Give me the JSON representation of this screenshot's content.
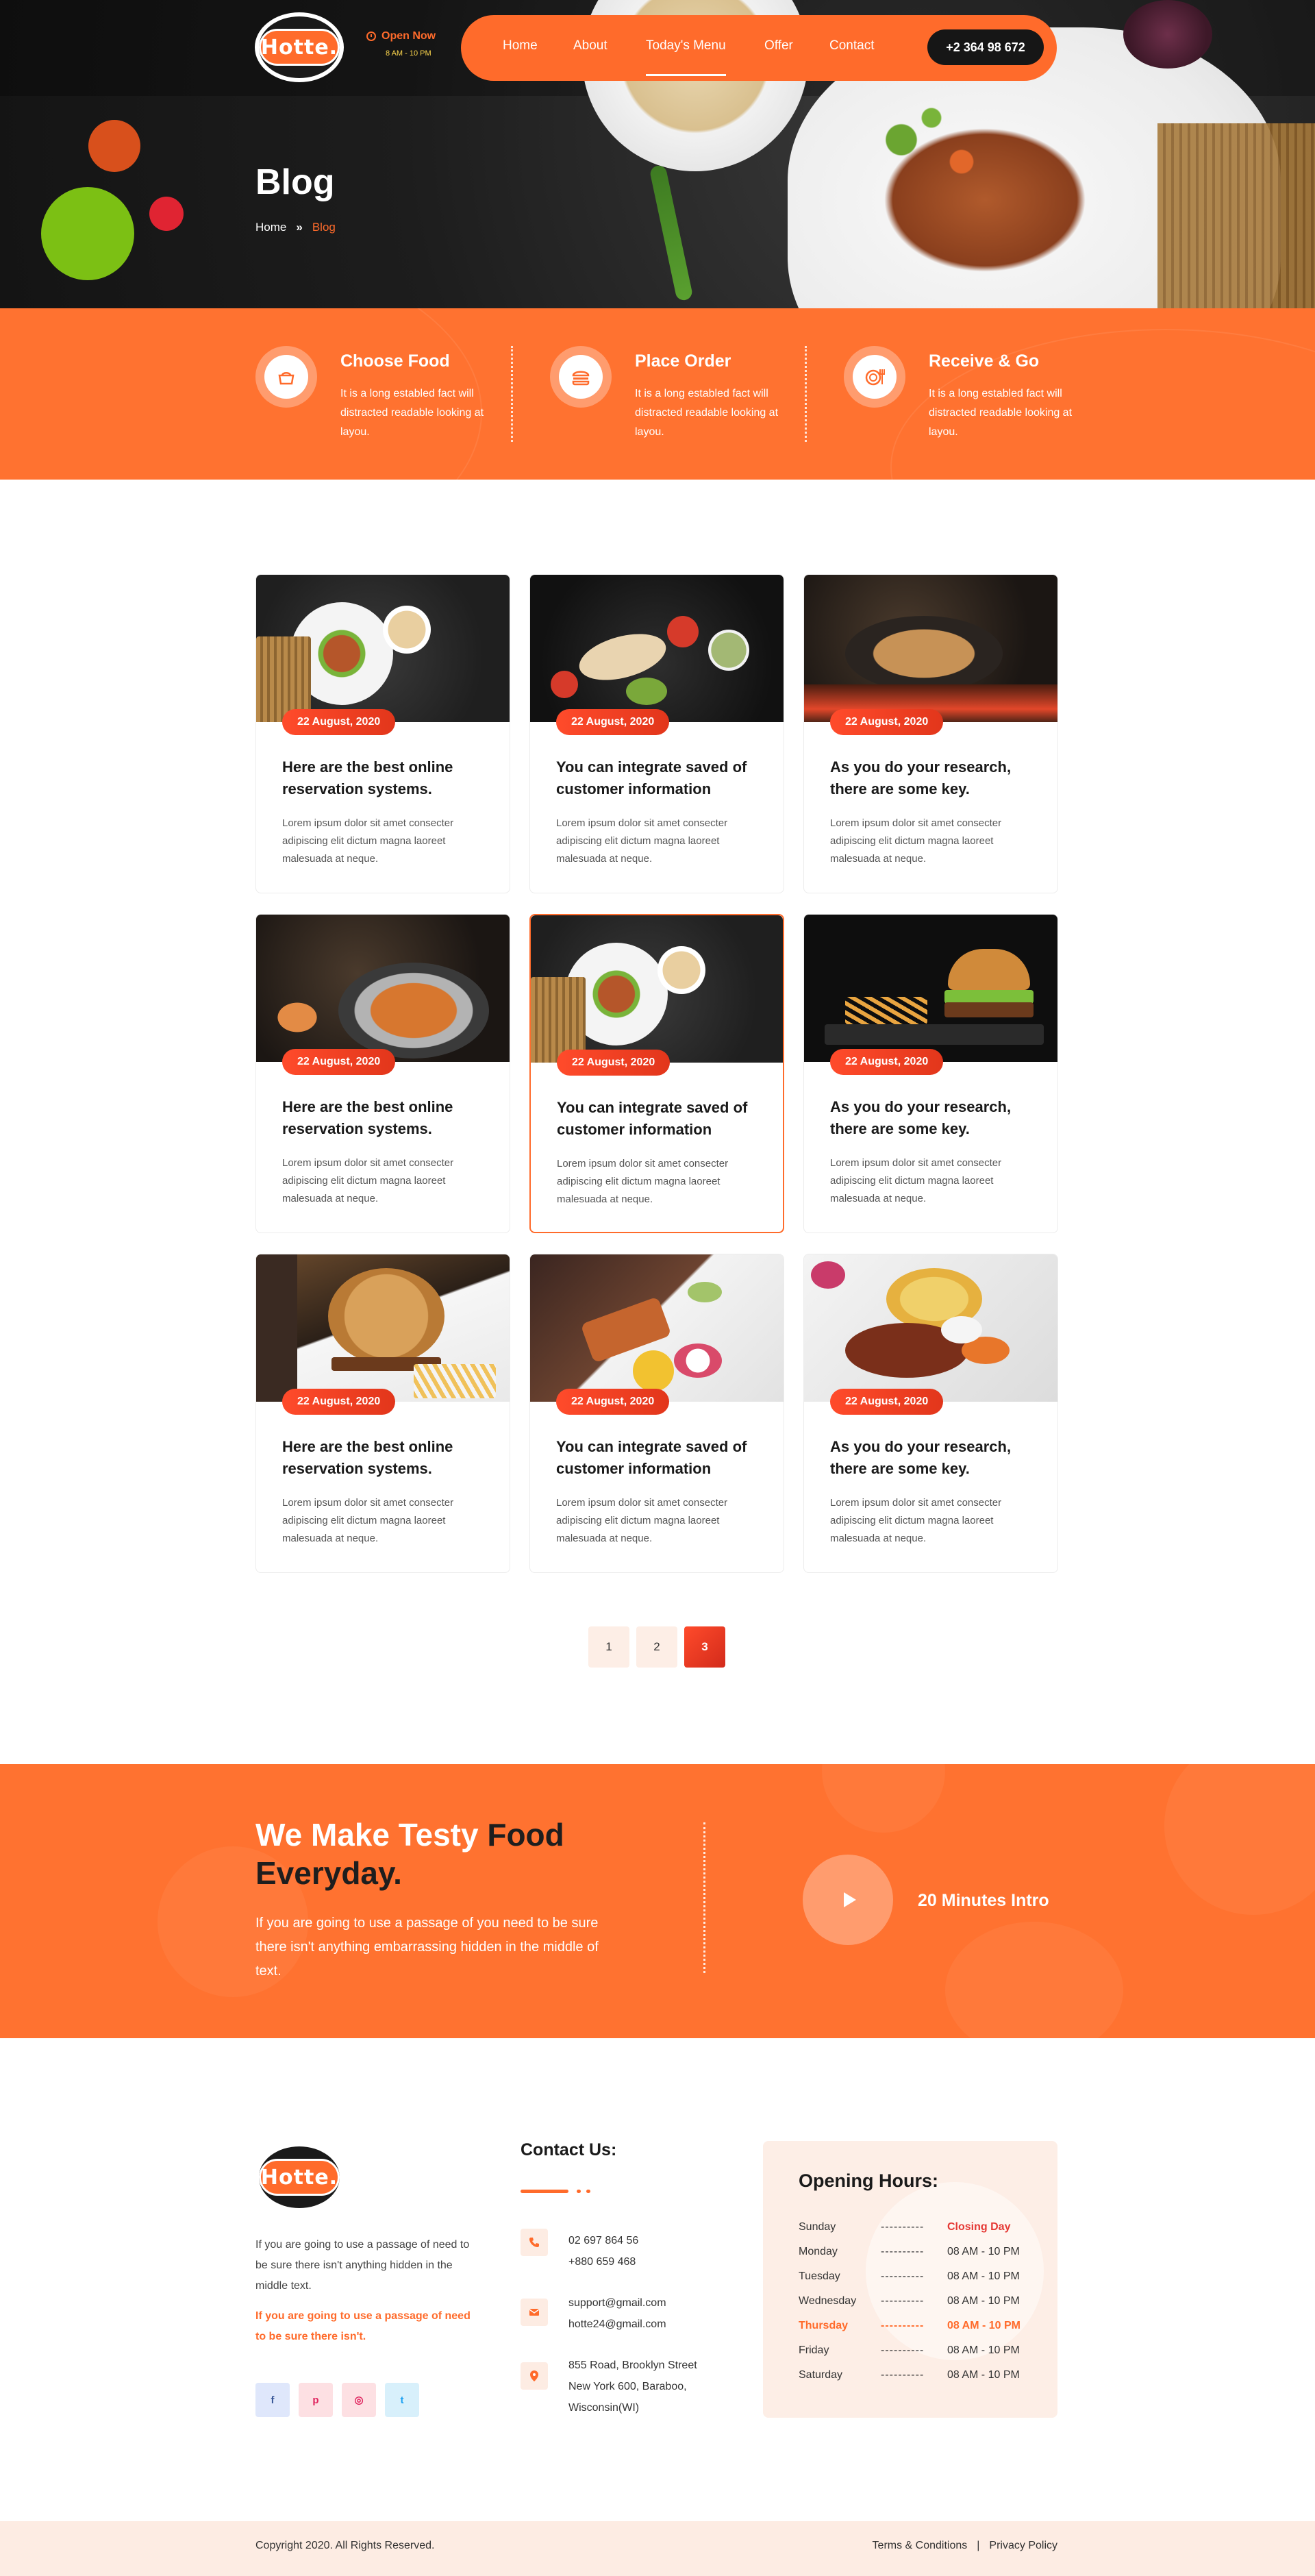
{
  "brand": {
    "logo_text": "Hotte."
  },
  "header": {
    "open_now": "Open Now",
    "hours": "8 AM - 10 PM",
    "nav": [
      "Home",
      "About",
      "Today's Menu",
      "Offer",
      "Contact"
    ],
    "active_nav": "Today's Menu",
    "phone": "+2 364 98 672"
  },
  "hero": {
    "title": "Blog",
    "breadcrumb_home": "Home",
    "breadcrumb_sep": "»",
    "breadcrumb_current": "Blog"
  },
  "steps": [
    {
      "title": "Choose Food",
      "desc": "It is a long establed fact will distracted readable looking at layou.",
      "icon": "food-basket-icon"
    },
    {
      "title": "Place Order",
      "desc": "It is a long establed fact will distracted readable looking at layou.",
      "icon": "burger-icon"
    },
    {
      "title": "Receive & Go",
      "desc": "It is a long establed fact will distracted readable looking at layou.",
      "icon": "plate-cutlery-icon"
    }
  ],
  "posts": [
    {
      "date": "22 August, 2020",
      "title": "Here are the best online reservation systems.",
      "excerpt": "Lorem ipsum dolor sit amet consecter adipiscing elit dictum magna laoreet malesuada at neque."
    },
    {
      "date": "22 August, 2020",
      "title": "You can integrate saved of customer information",
      "excerpt": "Lorem ipsum dolor sit amet consecter adipiscing elit dictum magna laoreet malesuada at neque."
    },
    {
      "date": "22 August, 2020",
      "title": "As you do your research, there are some key.",
      "excerpt": "Lorem ipsum dolor sit amet consecter adipiscing elit dictum magna laoreet malesuada at neque."
    },
    {
      "date": "22 August, 2020",
      "title": "Here are the best online reservation systems.",
      "excerpt": "Lorem ipsum dolor sit amet consecter adipiscing elit dictum magna laoreet malesuada at neque."
    },
    {
      "date": "22 August, 2020",
      "title": "You can integrate saved of customer information",
      "excerpt": "Lorem ipsum dolor sit amet consecter adipiscing elit dictum magna laoreet malesuada at neque."
    },
    {
      "date": "22 August, 2020",
      "title": "As you do your research, there are some key.",
      "excerpt": "Lorem ipsum dolor sit amet consecter adipiscing elit dictum magna laoreet malesuada at neque."
    },
    {
      "date": "22 August, 2020",
      "title": "Here are the best online reservation systems.",
      "excerpt": "Lorem ipsum dolor sit amet consecter adipiscing elit dictum magna laoreet malesuada at neque."
    },
    {
      "date": "22 August, 2020",
      "title": "You can integrate saved of customer information",
      "excerpt": "Lorem ipsum dolor sit amet consecter adipiscing elit dictum magna laoreet malesuada at neque."
    },
    {
      "date": "22 August, 2020",
      "title": "As you do your research, there are some key.",
      "excerpt": "Lorem ipsum dolor sit amet consecter adipiscing elit dictum magna laoreet malesuada at neque."
    }
  ],
  "pagination": {
    "pages": [
      "1",
      "2",
      "3"
    ],
    "active": "3"
  },
  "promo": {
    "title_white": "We Make Testy ",
    "title_dark": "Food Everyday.",
    "text": "If you are going to use a passage of you need to be sure there isn't anything embarrassing hidden in the middle of text.",
    "video_label": "20 Minutes Intro"
  },
  "footer": {
    "about": "If you are going to use a passage of need to be sure there isn't anything hidden in the middle text.",
    "about_accent": "If you are going to use a passage of need to be sure there isn't.",
    "social": [
      "f",
      "p",
      "◎",
      "t"
    ],
    "contact_title": "Contact Us:",
    "phones": [
      "02 697 864 56",
      "+880 659 468"
    ],
    "emails": [
      "support@gmail.com",
      "hotte24@gmail.com"
    ],
    "address": [
      "855 Road, Brooklyn Street",
      "New York 600, Baraboo,",
      "Wisconsin(WI)"
    ],
    "hours_title": "Opening Hours:",
    "hours": [
      {
        "day": "Sunday",
        "time": "Closing Day"
      },
      {
        "day": "Monday",
        "time": "08 AM - 10 PM"
      },
      {
        "day": "Tuesday",
        "time": "08 AM - 10 PM"
      },
      {
        "day": "Wednesday",
        "time": "08 AM - 10 PM"
      },
      {
        "day": "Thursday",
        "time": "08 AM - 10 PM"
      },
      {
        "day": "Friday",
        "time": "08 AM - 10 PM"
      },
      {
        "day": "Saturday",
        "time": "08 AM - 10 PM"
      }
    ],
    "dashes": "----------",
    "copyright": "Copyright 2020. All Rights Reserved.",
    "terms": "Terms & Conditions",
    "legal_sep": "|",
    "privacy": "Privacy Policy"
  },
  "colors": {
    "accent": "#ff6b2b",
    "dark": "#1a1a1a",
    "closing": "#e53935"
  }
}
